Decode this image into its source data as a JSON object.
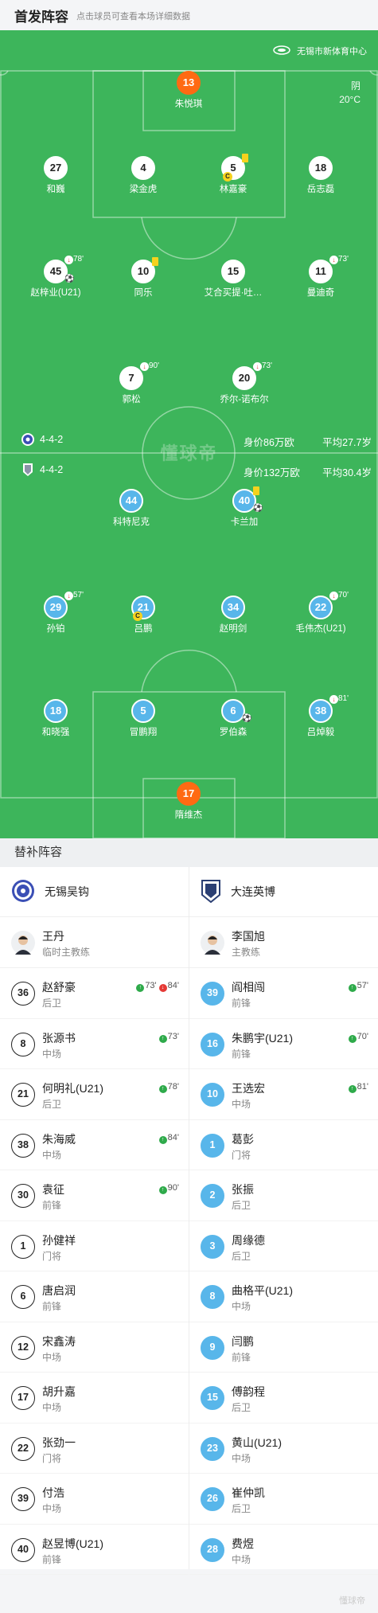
{
  "header": {
    "title": "首发阵容",
    "subtitle": "点击球员可查看本场详细数据"
  },
  "venue": "无锡市新体育中心",
  "weather": {
    "condition": "阴",
    "temp": "20°C"
  },
  "watermark": "懂球帝",
  "home_team": {
    "name": "无锡吴钩",
    "formation": "4-4-2",
    "value": "身价86万欧",
    "age": "平均27.7岁",
    "players": [
      {
        "num": "13",
        "name": "朱悦琪",
        "gk": true
      },
      {
        "num": "27",
        "name": "和巍"
      },
      {
        "num": "4",
        "name": "梁金虎"
      },
      {
        "num": "5",
        "name": "林嘉豪",
        "yellow": true,
        "captain": true
      },
      {
        "num": "18",
        "name": "岳志磊"
      },
      {
        "num": "45",
        "name": "赵梓业(U21)",
        "subout": "78'",
        "goal": true
      },
      {
        "num": "10",
        "name": "同乐",
        "yellow": true
      },
      {
        "num": "15",
        "name": "艾合买提·吐…"
      },
      {
        "num": "11",
        "name": "曼迪奇",
        "subout": "73'"
      },
      {
        "num": "7",
        "name": "郭松",
        "subout": "90'"
      },
      {
        "num": "20",
        "name": "乔尔-诺布尔",
        "subout": "73'"
      }
    ]
  },
  "away_team": {
    "name": "大连英博",
    "formation": "4-4-2",
    "value": "身价132万欧",
    "age": "平均30.4岁",
    "players": [
      {
        "num": "44",
        "name": "科特尼克"
      },
      {
        "num": "40",
        "name": "卡兰加",
        "yellow": true,
        "goal": true
      },
      {
        "num": "29",
        "name": "孙铂",
        "subout": "57'"
      },
      {
        "num": "21",
        "name": "吕鹏",
        "captain": true
      },
      {
        "num": "34",
        "name": "赵明剑"
      },
      {
        "num": "22",
        "name": "毛伟杰(U21)",
        "subout": "70'"
      },
      {
        "num": "18",
        "name": "和晓强"
      },
      {
        "num": "5",
        "name": "冒鹏翔"
      },
      {
        "num": "6",
        "name": "罗伯森",
        "goal": true
      },
      {
        "num": "38",
        "name": "吕焯毅",
        "subout": "81'"
      },
      {
        "num": "17",
        "name": "隋维杰",
        "gk": true
      }
    ]
  },
  "subs_title": "替补阵容",
  "home_coach": {
    "name": "王丹",
    "role": "临时主教练"
  },
  "away_coach": {
    "name": "李国旭",
    "role": "主教练"
  },
  "home_subs": [
    {
      "num": "36",
      "name": "赵舒豪",
      "pos": "后卫",
      "in": "73'",
      "out": "84'"
    },
    {
      "num": "8",
      "name": "张源书",
      "pos": "中场",
      "in": "73'"
    },
    {
      "num": "21",
      "name": "何明礼(U21)",
      "pos": "后卫",
      "in": "78'"
    },
    {
      "num": "38",
      "name": "朱海威",
      "pos": "中场",
      "in": "84'"
    },
    {
      "num": "30",
      "name": "袁征",
      "pos": "前锋",
      "in": "90'"
    },
    {
      "num": "1",
      "name": "孙健祥",
      "pos": "门将"
    },
    {
      "num": "6",
      "name": "唐启润",
      "pos": "前锋"
    },
    {
      "num": "12",
      "name": "宋鑫涛",
      "pos": "中场"
    },
    {
      "num": "17",
      "name": "胡升嘉",
      "pos": "中场"
    },
    {
      "num": "22",
      "name": "张劲一",
      "pos": "门将"
    },
    {
      "num": "39",
      "name": "付浩",
      "pos": "中场"
    },
    {
      "num": "40",
      "name": "赵昱博(U21)",
      "pos": "前锋"
    }
  ],
  "away_subs": [
    {
      "num": "39",
      "name": "阎相闯",
      "pos": "前锋",
      "in": "57'"
    },
    {
      "num": "16",
      "name": "朱鹏宇(U21)",
      "pos": "前锋",
      "in": "70'"
    },
    {
      "num": "10",
      "name": "王选宏",
      "pos": "中场",
      "in": "81'"
    },
    {
      "num": "1",
      "name": "葛彭",
      "pos": "门将"
    },
    {
      "num": "2",
      "name": "张振",
      "pos": "后卫"
    },
    {
      "num": "3",
      "name": "周缘德",
      "pos": "后卫"
    },
    {
      "num": "8",
      "name": "曲格平(U21)",
      "pos": "中场"
    },
    {
      "num": "9",
      "name": "闫鹏",
      "pos": "前锋"
    },
    {
      "num": "15",
      "name": "傅韵程",
      "pos": "后卫"
    },
    {
      "num": "23",
      "name": "黄山(U21)",
      "pos": "中场"
    },
    {
      "num": "26",
      "name": "崔仲凯",
      "pos": "后卫"
    },
    {
      "num": "28",
      "name": "费煜",
      "pos": "中场"
    }
  ],
  "colors": {
    "pitch": "#3db55b",
    "gk": "#ff6a13",
    "away": "#58b6ea",
    "yellow": "#f6d21d"
  }
}
